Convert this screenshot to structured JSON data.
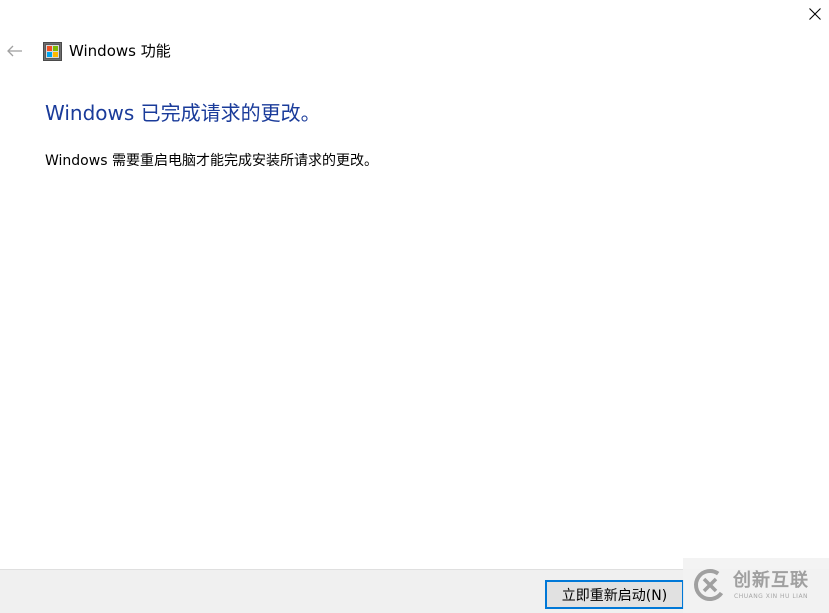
{
  "window": {
    "title": "Windows 功能"
  },
  "content": {
    "heading": "Windows 已完成请求的更改。",
    "message": "Windows 需要重启电脑才能完成安装所请求的更改。"
  },
  "footer": {
    "restart_label": "立即重新启动(N)"
  },
  "watermark": {
    "brand": "创新互联",
    "sub": "CHUANG XIN HU LIAN"
  },
  "icons": {
    "close": "close-icon",
    "back": "back-arrow-icon",
    "app": "windows-features-icon",
    "watermark_logo": "brand-logo-icon"
  },
  "colors": {
    "heading": "#1a3b9a",
    "button_border": "#0078d7",
    "footer_bg": "#f0f0f0"
  }
}
